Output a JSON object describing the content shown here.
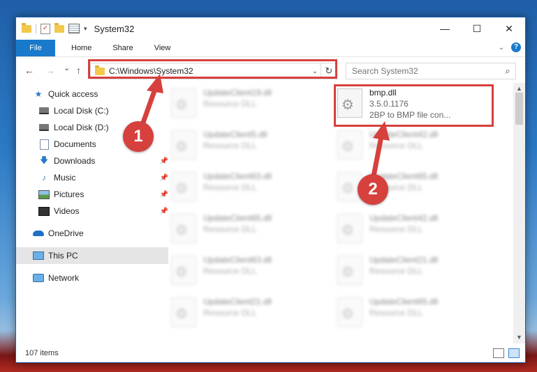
{
  "window": {
    "title": "System32",
    "controls": [
      "—",
      "☐",
      "✕"
    ]
  },
  "ribbon": {
    "file": "File",
    "tabs": [
      "Home",
      "Share",
      "View"
    ]
  },
  "nav": {
    "back": "←",
    "forward": "→",
    "recent": "⌄",
    "up": "↑",
    "address": "C:\\Windows\\System32",
    "refresh": "↻",
    "search_placeholder": "Search System32"
  },
  "sidebar": {
    "items": [
      {
        "label": "Quick access",
        "icon": "star-icon"
      },
      {
        "label": "Local Disk (C:)",
        "icon": "disk-icon"
      },
      {
        "label": "Local Disk (D:)",
        "icon": "disk-icon"
      },
      {
        "label": "Documents",
        "icon": "documents-icon"
      },
      {
        "label": "Downloads",
        "icon": "downloads-icon",
        "pinned": true
      },
      {
        "label": "Music",
        "icon": "music-icon",
        "pinned": true
      },
      {
        "label": "Pictures",
        "icon": "pictures-icon",
        "pinned": true
      },
      {
        "label": "Videos",
        "icon": "videos-icon",
        "pinned": true
      },
      {
        "label": "OneDrive",
        "icon": "onedrive-icon"
      },
      {
        "label": "This PC",
        "icon": "this-pc-icon",
        "selected": true
      },
      {
        "label": "Network",
        "icon": "network-icon"
      }
    ]
  },
  "files": {
    "highlighted": {
      "name": "bmp.dll",
      "version": "3.5.0.1176",
      "description": "2BP to BMP file con..."
    },
    "left_column": [
      {
        "name": "UpdateClient19.dll",
        "type": "Resource DLL"
      },
      {
        "name": "UpdateClient5.dll",
        "type": "Resource DLL"
      },
      {
        "name": "UpdateClient63.dll",
        "type": "Resource DLL"
      },
      {
        "name": "UpdateClient65.dll",
        "type": "Resource DLL"
      },
      {
        "name": "UpdateClient63.dll",
        "type": "Resource DLL"
      },
      {
        "name": "UpdateClient21.dll",
        "type": "Resource DLL"
      }
    ],
    "right_column": [
      {
        "name": "UpdateClient42.dll",
        "type": "Resource DLL"
      },
      {
        "name": "UpdateClient65.dll",
        "type": "Resource DLL"
      },
      {
        "name": "UpdateClient42.dll",
        "type": "Resource DLL"
      },
      {
        "name": "UpdateClient21.dll",
        "type": "Resource DLL"
      },
      {
        "name": "UpdateClient65.dll",
        "type": "Resource DLL"
      }
    ]
  },
  "status": {
    "count": "107 items"
  },
  "annotations": {
    "step1": "1",
    "step2": "2",
    "color": "#d6403d"
  }
}
